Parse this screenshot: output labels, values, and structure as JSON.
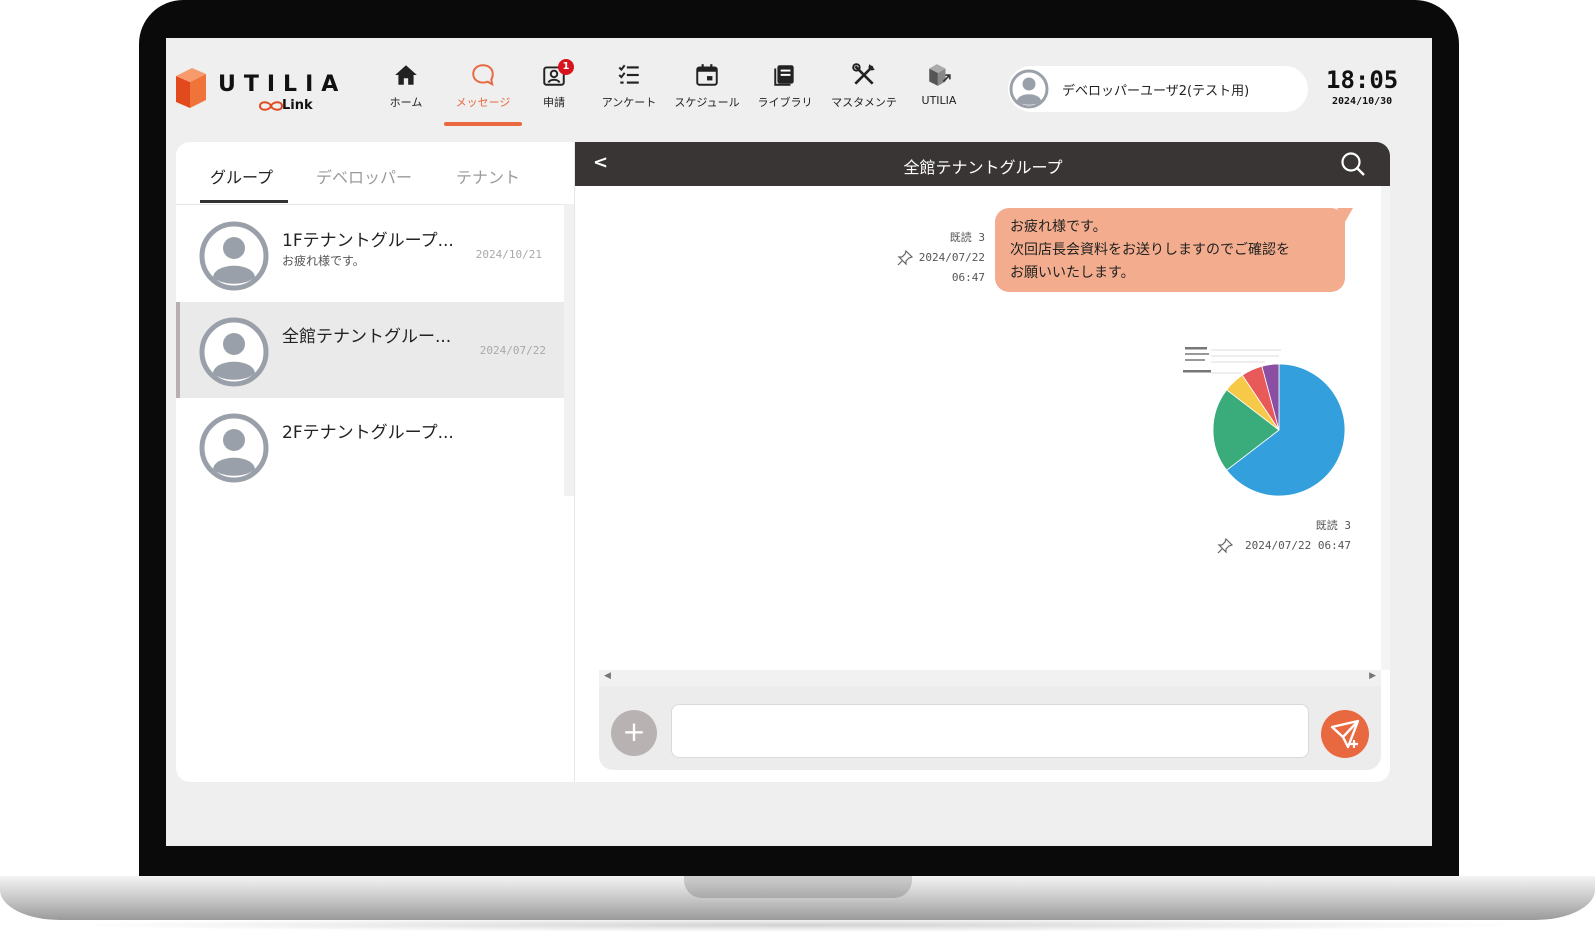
{
  "app": {
    "logo_text": "UTILIA",
    "logo_sub": "Link"
  },
  "nav": [
    {
      "label": "ホーム",
      "icon": "home-icon"
    },
    {
      "label": "メッセージ",
      "icon": "message-icon",
      "active": true
    },
    {
      "label": "申請",
      "icon": "application-icon",
      "badge": "1"
    },
    {
      "label": "アンケート",
      "icon": "survey-list-icon"
    },
    {
      "label": "スケジュール",
      "icon": "calendar-icon"
    },
    {
      "label": "ライブラリ",
      "icon": "library-icon"
    },
    {
      "label": "マスタメンテ",
      "icon": "tools-icon"
    },
    {
      "label": "UTILIA",
      "icon": "utilia-link-icon"
    }
  ],
  "user": {
    "name": "デベロッパーユーザ2(テスト用)"
  },
  "clock": {
    "time": "18:05",
    "date": "2024/10/30"
  },
  "tabs": [
    "グループ",
    "デベロッパー",
    "テナント"
  ],
  "groups": [
    {
      "name": "1Fテナントグループ...",
      "last_message": "お疲れ様です。",
      "date": "2024/10/21"
    },
    {
      "name": "全館テナントグルー...",
      "last_message": "",
      "date": "2024/07/22",
      "selected": true
    },
    {
      "name": "2Fテナントグループ...",
      "last_message": "",
      "date": ""
    }
  ],
  "chat": {
    "title": "全館テナントグループ",
    "messages": [
      {
        "read": "既読 3",
        "date": "2024/07/22",
        "time": "06:47",
        "lines": [
          "お疲れ様です。",
          "次回店長会資料をお送りしますのでご確認を",
          "お願いいたします。"
        ]
      },
      {
        "read": "既読 3",
        "datetime": "2024/07/22 06:47",
        "attachment": "pie-chart-image"
      }
    ],
    "input_placeholder": ""
  },
  "colors": {
    "accent": "#e8683f",
    "header_dark": "#3a3535",
    "bubble": "#f3ad8e"
  },
  "chart_data": {
    "type": "pie",
    "title": "",
    "values": [
      62,
      20,
      5,
      5,
      4
    ],
    "colors": [
      "#33a0dd",
      "#3aac7b",
      "#f7c948",
      "#e85a5a",
      "#8a4fa3"
    ]
  }
}
